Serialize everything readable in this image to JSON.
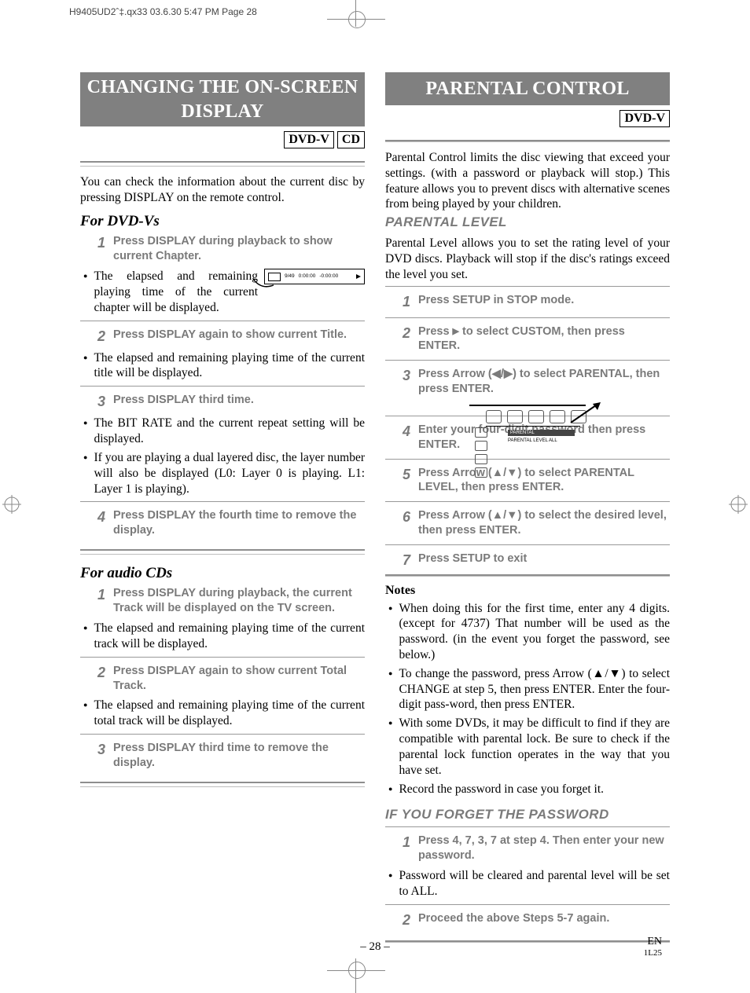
{
  "print_header": "H9405UD2ˆ‡.qx33   03.6.30  5:47 PM   Page 28",
  "left": {
    "title": "CHANGING THE ON-SCREEN DISPLAY",
    "formats": [
      "DVD-V",
      "CD"
    ],
    "intro": "You can check the information about the current disc by pressing DISPLAY on the remote control.",
    "dvd_head": "For DVD-Vs",
    "dvd_steps": [
      "Press DISPLAY during playback to show current Chapter.",
      "Press DISPLAY again to show current Title.",
      "Press DISPLAY third time.",
      "Press DISPLAY the fourth time to remove the display."
    ],
    "dvd_bul1": "The elapsed and remaining playing time of the current chapter will be displayed.",
    "dvd_bul2": "The elapsed and remaining playing time of the current title will be displayed.",
    "dvd_bul3": "The BIT RATE and the current repeat setting will be displayed.",
    "dvd_bul4": "If you are playing a dual layered disc, the layer number will also be displayed (L0: Layer 0 is playing. L1: Layer 1 is playing).",
    "osd": {
      "chapter": "9/49",
      "elapsed": "0:00:00",
      "remain": "-0:00:00"
    },
    "cd_head": "For audio CDs",
    "cd_steps": [
      "Press DISPLAY during playback, the current Track will be displayed on the TV screen.",
      "Press DISPLAY again to show current Total Track.",
      "Press DISPLAY third time to remove the display."
    ],
    "cd_bul1": "The elapsed and remaining playing time of the current track will be displayed.",
    "cd_bul2": "The elapsed and remaining playing time of the current total track will be displayed."
  },
  "right": {
    "title": "PARENTAL CONTROL",
    "formats": [
      "DVD-V"
    ],
    "intro": "Parental Control limits the disc viewing that exceed your settings. (with a password or playback will stop.) This feature allows you to prevent discs with alternative scenes from being played by your children.",
    "pl_head": "PARENTAL LEVEL",
    "pl_intro": "Parental Level allows you to set the rating level of your DVD discs. Playback will stop if the disc's ratings exceed the level you set.",
    "steps": [
      "Press SETUP in STOP mode.",
      "Press ▶ to select CUSTOM, then press ENTER.",
      "Press Arrow (◀/▶) to select PARENTAL, then press ENTER.",
      "Enter your four-digit password then press ENTER.",
      "Press Arrow (▲/▼) to select PARENTAL LEVEL, then press ENTER.",
      "Press Arrow (▲/▼) to select the desired level, then press ENTER.",
      "Press SETUP to exit"
    ],
    "menu": {
      "bar": "PARENTAL",
      "label": "PARENTAL LEVEL    ALL"
    },
    "notes_h": "Notes",
    "notes": [
      "When doing this for the first time, enter any 4 digits. (except for 4737) That number will be used as the password. (in the event you forget the password, see below.)",
      "To change the password, press Arrow (▲/▼) to select CHANGE at step 5, then press ENTER. Enter the four-digit pass-word, then press ENTER.",
      "With some DVDs, it may be difficult to find if they are compatible with parental lock. Be sure to check if the parental lock function operates in the way that you have set.",
      "Record the password in case you forget it."
    ],
    "fp_head": "IF YOU FORGET THE PASSWORD",
    "fp_step1": "Press 4, 7, 3, 7 at step 4. Then enter your new password.",
    "fp_bul": "Password will be cleared and parental level will be set to ALL.",
    "fp_step2": "Proceed the above Steps 5-7 again."
  },
  "footer": {
    "page": "– 28 –",
    "lang": "EN",
    "code": "1L25"
  }
}
